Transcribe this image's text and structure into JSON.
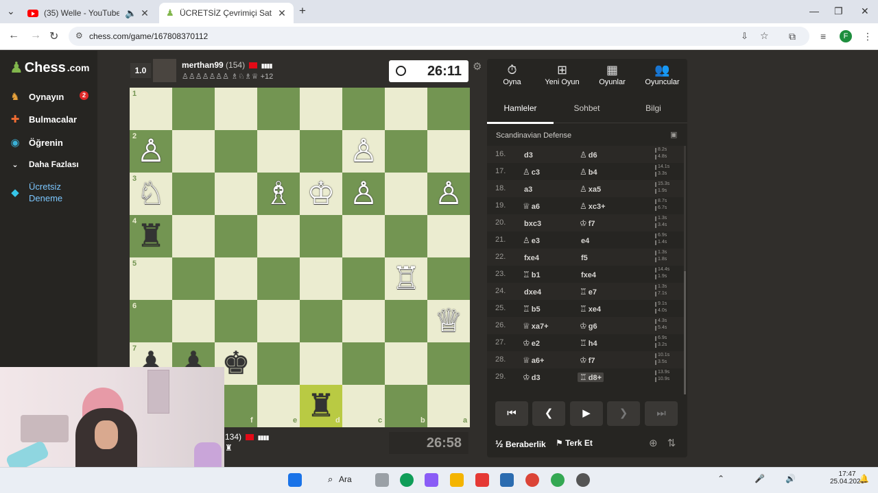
{
  "browser": {
    "tabs": [
      {
        "title": "(35) Welle - YouTube",
        "active": false
      },
      {
        "title": "ÜCRETSİZ Çevrimiçi Satranç Oy",
        "active": true
      }
    ],
    "url": "chess.com/game/167808370112"
  },
  "sidebar": {
    "logo": "Chess",
    "logo_suffix": ".com",
    "items": [
      {
        "label": "Oynayın",
        "icon": "play-icon",
        "badge": "2"
      },
      {
        "label": "Bulmacalar",
        "icon": "puzzle-icon"
      },
      {
        "label": "Öğrenin",
        "icon": "learn-icon"
      },
      {
        "label": "Daha Fazlası",
        "icon": "chevron-down-icon"
      },
      {
        "label": "Ücretsiz Deneme",
        "icon": "diamond-icon"
      }
    ]
  },
  "top_player": {
    "score": "1.0",
    "name": "merthan99",
    "rating": "(154)",
    "captured_text": "+12",
    "clock": "26:11"
  },
  "bottom_player": {
    "name_fragment": "134)",
    "clock": "26:58"
  },
  "board": {
    "ranks": [
      "1",
      "2",
      "3",
      "4",
      "5",
      "6",
      "7"
    ],
    "files": [
      "f",
      "e",
      "d",
      "c",
      "b",
      "a"
    ]
  },
  "panel": {
    "top_nav": [
      {
        "label": "Oyna",
        "icon": "stopwatch-icon"
      },
      {
        "label": "Yeni Oyun",
        "icon": "plus-icon"
      },
      {
        "label": "Oyunlar",
        "icon": "board-icon"
      },
      {
        "label": "Oyuncular",
        "icon": "players-icon"
      }
    ],
    "subtabs": [
      "Hamleler",
      "Sohbet",
      "Bilgi"
    ],
    "opening": "Scandinavian Defense",
    "moves": [
      {
        "num": "16.",
        "w": "d3",
        "wg": "",
        "b": "d6",
        "bg": "♙",
        "tw": "8.2s",
        "tb": "4.8s"
      },
      {
        "num": "17.",
        "w": "c3",
        "wg": "♙",
        "b": "b4",
        "bg": "♙",
        "tw": "14.1s",
        "tb": "3.3s"
      },
      {
        "num": "18.",
        "w": "a3",
        "wg": "",
        "b": "xa5",
        "bg": "♙",
        "tw": "15.3s",
        "tb": "1.9s"
      },
      {
        "num": "19.",
        "w": "a6",
        "wg": "♕",
        "b": "xc3+",
        "bg": "♙",
        "tw": "8.7s",
        "tb": "6.7s"
      },
      {
        "num": "20.",
        "w": "bxc3",
        "wg": "",
        "b": "f7",
        "bg": "♔",
        "tw": "1.3s",
        "tb": "3.4s"
      },
      {
        "num": "21.",
        "w": "e3",
        "wg": "♙",
        "b": "e4",
        "bg": "",
        "tw": "6.9s",
        "tb": "1.4s"
      },
      {
        "num": "22.",
        "w": "fxe4",
        "wg": "",
        "b": "f5",
        "bg": "",
        "tw": "1.3s",
        "tb": "1.8s"
      },
      {
        "num": "23.",
        "w": "b1",
        "wg": "♖",
        "b": "fxe4",
        "bg": "",
        "tw": "14.4s",
        "tb": "1.9s"
      },
      {
        "num": "24.",
        "w": "dxe4",
        "wg": "",
        "b": "e7",
        "bg": "♖",
        "tw": "1.3s",
        "tb": "7.1s"
      },
      {
        "num": "25.",
        "w": "b5",
        "wg": "♖",
        "b": "xe4",
        "bg": "♖",
        "tw": "9.1s",
        "tb": "4.0s"
      },
      {
        "num": "26.",
        "w": "xa7+",
        "wg": "♕",
        "b": "g6",
        "bg": "♔",
        "tw": "4.3s",
        "tb": "5.4s"
      },
      {
        "num": "27.",
        "w": "e2",
        "wg": "♔",
        "b": "h4",
        "bg": "♖",
        "tw": "6.9s",
        "tb": "3.2s"
      },
      {
        "num": "28.",
        "w": "a6+",
        "wg": "♕",
        "b": "f7",
        "bg": "♔",
        "tw": "10.1s",
        "tb": "3.5s"
      },
      {
        "num": "29.",
        "w": "d3",
        "wg": "♔",
        "b": "d8+",
        "bg": "♖",
        "tw": "13.9s",
        "tb": "10.9s"
      }
    ],
    "draw_label": "Beraberlik",
    "draw_symbol": "½",
    "resign_label": "Terk Et"
  },
  "taskbar": {
    "search_label": "Ara",
    "time": "17:47",
    "date": "25.04.2026"
  }
}
